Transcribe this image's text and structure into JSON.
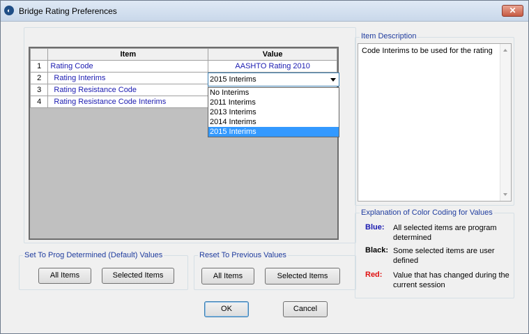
{
  "window": {
    "title": "Bridge Rating Preferences",
    "close_label": "✕"
  },
  "grid": {
    "columns": [
      "",
      "Item",
      "Value"
    ],
    "rows": [
      {
        "num": "1",
        "item": "Rating Code",
        "value": "AASHTO Rating 2010"
      },
      {
        "num": "2",
        "item": "Rating Interims",
        "value": "2015 Interims"
      },
      {
        "num": "3",
        "item": "Rating Resistance Code",
        "value": ""
      },
      {
        "num": "4",
        "item": "Rating Resistance Code Interims",
        "value": ""
      }
    ],
    "dropdown": {
      "selected": "2015 Interims",
      "options": [
        "No Interims",
        "2011 Interims",
        "2013 Interims",
        "2014 Interims",
        "2015 Interims"
      ]
    }
  },
  "item_description": {
    "label": "Item Description",
    "text": "Code Interims to be used for the rating"
  },
  "color_coding": {
    "label": "Explanation of Color Coding for Values",
    "entries": [
      {
        "key": "Blue:",
        "color": "#1a1ab0",
        "text": "All selected items are program determined"
      },
      {
        "key": "Black:",
        "color": "#000000",
        "text": "Some selected items are user defined"
      },
      {
        "key": "Red:",
        "color": "#e01010",
        "text": "Value that has changed during the current session"
      }
    ]
  },
  "set_default": {
    "label": "Set To Prog Determined (Default) Values",
    "all": "All Items",
    "selected": "Selected Items"
  },
  "reset_previous": {
    "label": "Reset To Previous Values",
    "all": "All Items",
    "selected": "Selected Items"
  },
  "buttons": {
    "ok": "OK",
    "cancel": "Cancel"
  }
}
